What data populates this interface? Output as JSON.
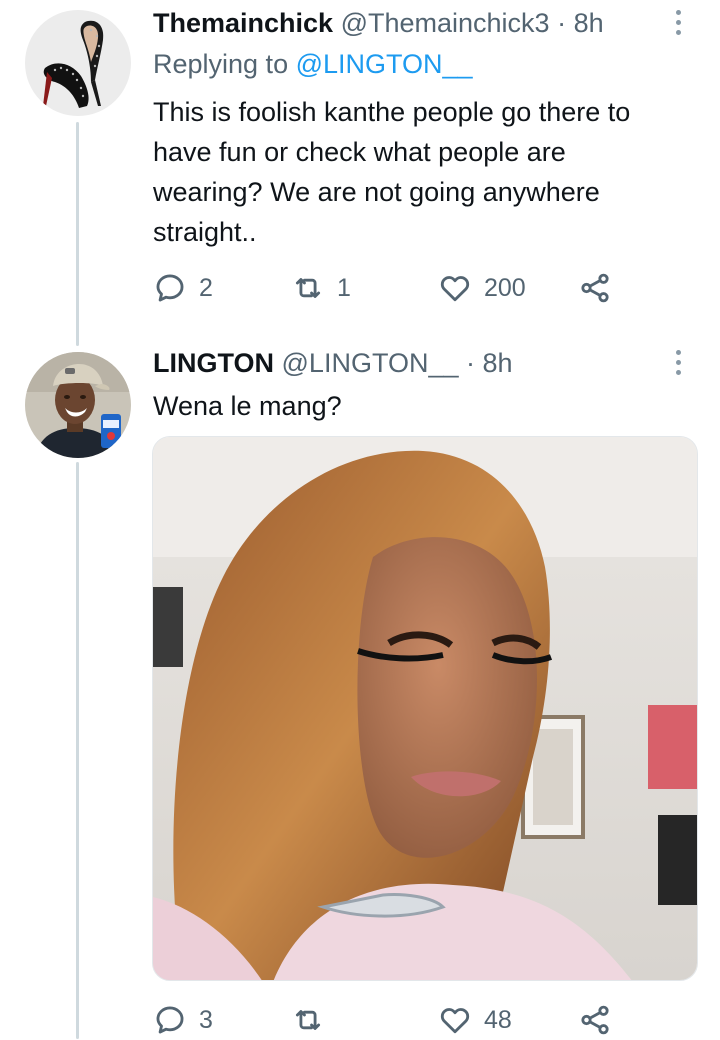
{
  "tweets": [
    {
      "display_name": "Themainchick",
      "handle": "@Themainchick3",
      "time": "8h",
      "replying_prefix": "Replying to",
      "replying_handle": "@LINGTON__",
      "text": "This is foolish kanthe people go there to\nhave fun or check what people are\nwearing? We are not going anywhere\nstraight..",
      "replies": "2",
      "retweets": "1",
      "likes": "200"
    },
    {
      "display_name": "LINGTON",
      "handle": "@LINGTON__",
      "time": "8h",
      "text": "Wena le mang?",
      "replies": "3",
      "retweets": "",
      "likes": "48"
    }
  ],
  "meta_separator": "·",
  "icons": {
    "reply": "reply-icon",
    "retweet": "retweet-icon",
    "like": "heart-icon",
    "share": "share-icon",
    "more": "more-icon"
  },
  "colors": {
    "link": "#1d9bf0",
    "secondary_text": "#536471",
    "thread_line": "#cfd9de"
  }
}
